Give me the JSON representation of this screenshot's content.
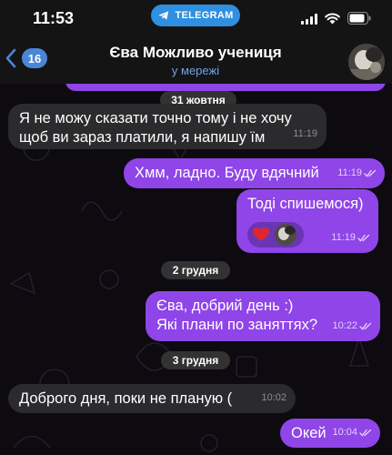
{
  "status_bar": {
    "time": "11:53",
    "app_pill": "TELEGRAM",
    "icons": [
      "signal-icon",
      "wifi-icon",
      "battery-icon"
    ]
  },
  "header": {
    "back_badge": "16",
    "title": "Єва Можливо учениця",
    "subtitle": "у мережі"
  },
  "colors": {
    "incoming_bubble": "#2b2b2d",
    "outgoing_bubble": "#8f45e8",
    "accent": "#4a86d8",
    "online": "#6fa3e8",
    "reaction_heart": "#e0262c"
  },
  "messages": [
    {
      "date": "31 жовтня"
    },
    {
      "from": "contact",
      "text": [
        "Я не можу сказати точно тому і не хочу",
        "щоб ви зараз платили,  я напишу їм"
      ],
      "time": "11:19"
    },
    {
      "from": "me",
      "text": [
        "Хмм, ладно. Буду вдячний"
      ],
      "time": "11:19",
      "status": "read"
    },
    {
      "from": "me",
      "text": [
        "Тоді спишемося)"
      ],
      "time": "11:19",
      "status": "read",
      "reaction": "heart"
    },
    {
      "date": "2 грудня"
    },
    {
      "from": "me",
      "text": [
        "Єва, добрий день :)",
        "Які плани по заняттях?"
      ],
      "time": "10:22",
      "status": "read"
    },
    {
      "date": "3 грудня"
    },
    {
      "from": "contact",
      "text": [
        "Доброго дня, поки не планую ("
      ],
      "time": "10:02"
    },
    {
      "from": "me",
      "text": [
        "Окей"
      ],
      "time": "10:04",
      "status": "read"
    }
  ]
}
